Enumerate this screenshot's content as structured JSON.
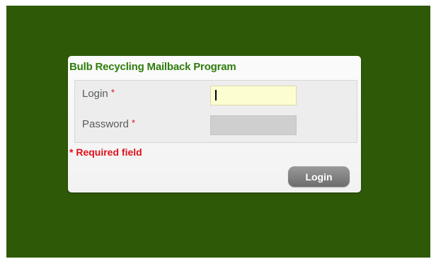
{
  "card": {
    "title": "Bulb Recycling Mailback Program"
  },
  "fields": {
    "login_label": "Login",
    "password_label": "Password",
    "required_marker": "*",
    "login_value": "",
    "password_value": ""
  },
  "required_note": "* Required field",
  "login_button_label": "Login",
  "colors": {
    "page_background": "#2e5a08",
    "title_color": "#2f7d0c",
    "required_color": "#e0101a",
    "login_input_background": "#fdfdd2",
    "password_input_background": "#cfcfcf",
    "button_background": "#808080"
  }
}
